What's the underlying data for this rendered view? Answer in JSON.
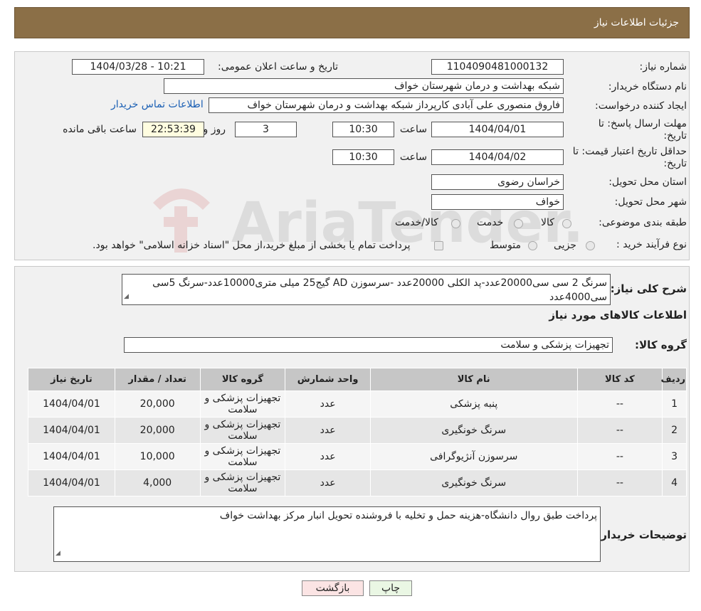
{
  "header": {
    "title": "جزئیات اطلاعات نیاز"
  },
  "watermark": {
    "text": "AriaTender.neT"
  },
  "form": {
    "need_number_label": "شماره نیاز:",
    "need_number": "1104090481000132",
    "announce_label": "تاریخ و ساعت اعلان عمومی:",
    "announce_value": "1404/03/28 - 10:21",
    "buyer_org_label": "نام دستگاه خریدار:",
    "buyer_org": "شبکه بهداشت و درمان شهرستان خواف",
    "creator_label": "ایجاد کننده درخواست:",
    "creator": "فاروق منصوری علی آبادی کارپرداز شبکه بهداشت و درمان شهرستان خواف",
    "contact_link": "اطلاعات تماس خریدار",
    "reply_deadline_label": "مهلت ارسال پاسخ: تا تاریخ:",
    "reply_date": "1404/04/01",
    "time_label": "ساعت",
    "reply_time": "10:30",
    "days_value": "3",
    "days_label": "روز و",
    "remaining_time": "22:53:39",
    "remaining_label": "ساعت باقی مانده",
    "validity_label": "حداقل تاریخ اعتبار قیمت: تا تاریخ:",
    "validity_date": "1404/04/02",
    "validity_time": "10:30",
    "province_label": "استان محل تحویل:",
    "province": "خراسان رضوی",
    "city_label": "شهر محل تحویل:",
    "city": "خواف",
    "category_label": "طبقه بندی موضوعی:",
    "category_options": [
      "کالا",
      "خدمت",
      "کالا/خدمت"
    ],
    "purchase_type_label": "نوع فرآیند خرید :",
    "purchase_options": [
      "جزیی",
      "متوسط"
    ],
    "purchase_note": "پرداخت تمام یا بخشی از مبلغ خرید،از محل \"اسناد خزانه اسلامی\" خواهد بود."
  },
  "summary": {
    "desc_label": "شرح کلی نیاز:",
    "desc_text": "سرنگ 2 سی سی20000عدد-پد الکلی 20000عدد -سرسوزن AD گیج25 میلی متری10000عدد-سرنگ 5سی سی4000عدد",
    "goods_info_title": "اطلاعات کالاهای مورد نیاز",
    "group_label": "گروه کالا:",
    "group_value": "تجهیزات پزشکی و سلامت"
  },
  "table": {
    "headers": [
      "ردیف",
      "کد کالا",
      "نام کالا",
      "واحد شمارش",
      "گروه کالا",
      "تعداد / مقدار",
      "تاریخ نیاز"
    ],
    "rows": [
      [
        "1",
        "--",
        "پنبه پزشکی",
        "عدد",
        "تجهیزات پزشکی و سلامت",
        "20,000",
        "1404/04/01"
      ],
      [
        "2",
        "--",
        "سرنگ خونگیری",
        "عدد",
        "تجهیزات پزشکی و سلامت",
        "20,000",
        "1404/04/01"
      ],
      [
        "3",
        "--",
        "سرسوزن آنژیوگرافی",
        "عدد",
        "تجهیزات پزشکی و سلامت",
        "10,000",
        "1404/04/01"
      ],
      [
        "4",
        "--",
        "سرنگ خونگیری",
        "عدد",
        "تجهیزات پزشکی و سلامت",
        "4,000",
        "1404/04/01"
      ]
    ]
  },
  "buyer_notes": {
    "label": "توضیحات خریدار:",
    "text": "پرداخت طبق روال دانشگاه-هزینه حمل و تخلیه با فروشنده تحویل انبار مرکز بهداشت خواف"
  },
  "buttons": {
    "print": "چاپ",
    "back": "بازگشت"
  }
}
